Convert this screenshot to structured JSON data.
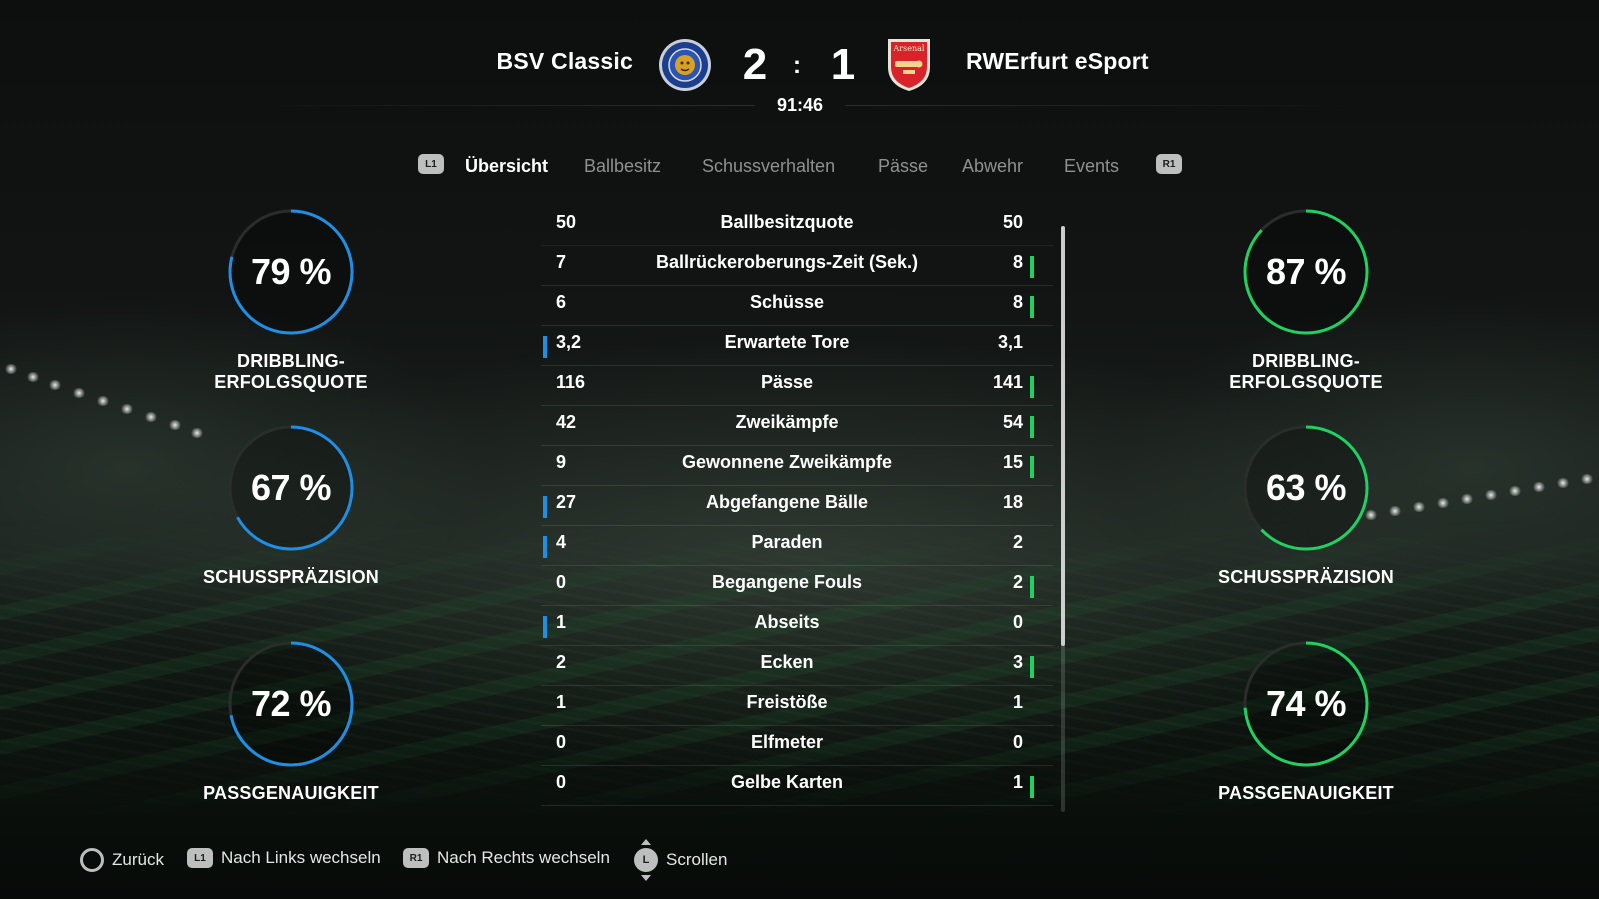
{
  "header": {
    "home_team": "BSV Classic",
    "away_team": "RWErfurt eSport",
    "home_score": "2",
    "away_score": "1",
    "separator": ":",
    "clock": "91:46",
    "away_crest_text": "Arsenal"
  },
  "tabs": {
    "left_button": "L1",
    "right_button": "R1",
    "items": [
      "Übersicht",
      "Ballbesitz",
      "Schussverhalten",
      "Pässe",
      "Abwehr",
      "Events"
    ],
    "active": "Übersicht"
  },
  "gauges": {
    "home": [
      {
        "value_text": "79 %",
        "value": 79,
        "label": "DRIBBLING-ERFOLGSQUOTE"
      },
      {
        "value_text": "67 %",
        "value": 67,
        "label": "SCHUSSPRÄZISION"
      },
      {
        "value_text": "72 %",
        "value": 72,
        "label": "PASSGENAUIGKEIT"
      }
    ],
    "away": [
      {
        "value_text": "87 %",
        "value": 87,
        "label": "DRIBBLING-ERFOLGSQUOTE"
      },
      {
        "value_text": "63 %",
        "value": 63,
        "label": "SCHUSSPRÄZISION"
      },
      {
        "value_text": "74 %",
        "value": 74,
        "label": "PASSGENAUIGKEIT"
      }
    ],
    "home_color": "#1f8fe6",
    "away_color": "#1fd160",
    "track_color": "#2a2d2c"
  },
  "stats": [
    {
      "label": "Ballbesitzquote",
      "home": "50",
      "away": "50",
      "leader": "none"
    },
    {
      "label": "Ballrückeroberungs-Zeit (Sek.)",
      "home": "7",
      "away": "8",
      "leader": "away"
    },
    {
      "label": "Schüsse",
      "home": "6",
      "away": "8",
      "leader": "away"
    },
    {
      "label": "Erwartete Tore",
      "home": "3,2",
      "away": "3,1",
      "leader": "home"
    },
    {
      "label": "Pässe",
      "home": "116",
      "away": "141",
      "leader": "away"
    },
    {
      "label": "Zweikämpfe",
      "home": "42",
      "away": "54",
      "leader": "away"
    },
    {
      "label": "Gewonnene Zweikämpfe",
      "home": "9",
      "away": "15",
      "leader": "away"
    },
    {
      "label": "Abgefangene Bälle",
      "home": "27",
      "away": "18",
      "leader": "home"
    },
    {
      "label": "Paraden",
      "home": "4",
      "away": "2",
      "leader": "home"
    },
    {
      "label": "Begangene Fouls",
      "home": "0",
      "away": "2",
      "leader": "away"
    },
    {
      "label": "Abseits",
      "home": "1",
      "away": "0",
      "leader": "home"
    },
    {
      "label": "Ecken",
      "home": "2",
      "away": "3",
      "leader": "away"
    },
    {
      "label": "Freistöße",
      "home": "1",
      "away": "1",
      "leader": "none"
    },
    {
      "label": "Elfmeter",
      "home": "0",
      "away": "0",
      "leader": "none"
    },
    {
      "label": "Gelbe Karten",
      "home": "0",
      "away": "1",
      "leader": "away"
    }
  ],
  "footer": {
    "back": "Zurück",
    "prev_button": "L1",
    "prev": "Nach Links wechseln",
    "next_button": "R1",
    "next": "Nach Rechts wechseln",
    "scroll_button": "L",
    "scroll": "Scrollen"
  }
}
